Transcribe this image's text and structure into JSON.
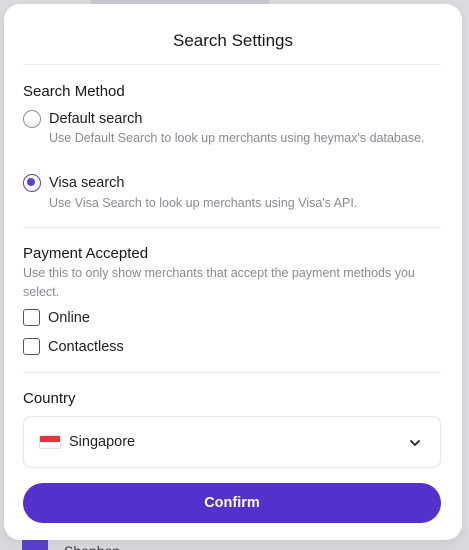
{
  "modal": {
    "title": "Search Settings"
  },
  "search_method": {
    "title": "Search Method",
    "options": [
      {
        "label": "Default search",
        "help": "Use Default Search to look up merchants using heymax's database.",
        "selected": false
      },
      {
        "label": "Visa search",
        "help": "Use Visa Search to look up merchants using Visa's API.",
        "selected": true
      }
    ]
  },
  "payment_accepted": {
    "title": "Payment Accepted",
    "description": "Use this to only show merchants that accept the payment methods you select.",
    "options": [
      {
        "label": "Online",
        "checked": false
      },
      {
        "label": "Contactless",
        "checked": false
      }
    ]
  },
  "country": {
    "title": "Country",
    "selected": "Singapore",
    "flag_icon": "singapore-flag-icon",
    "dropdown_icon": "chevron-down-icon"
  },
  "actions": {
    "confirm_label": "Confirm"
  },
  "background": {
    "partial_text": "Shopbop"
  },
  "colors": {
    "accent": "#5430cc",
    "radio_selected": "#5b3fd6",
    "muted_text": "#8a8a93"
  }
}
